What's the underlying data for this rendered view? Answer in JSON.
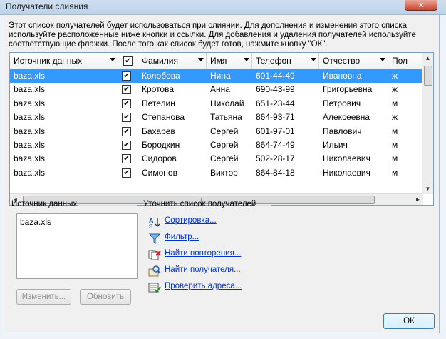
{
  "window": {
    "title": "Получатели слияния",
    "close_label": "x"
  },
  "description": "Этот список получателей будет использоваться при слиянии. Для дополнения и изменения этого списка используйте расположенные ниже кнопки и ссылки. Для добавления и удаления получателей используйте соответствующие флажки. После того как список будет готов, нажмите кнопку \"ОК\".",
  "grid": {
    "columns": [
      "Источник данных",
      "",
      "Фамилия",
      "Имя",
      "Телефон",
      "Отчество",
      "Пол"
    ],
    "rows": [
      {
        "source": "baza.xls",
        "checked": true,
        "last": "Колобова",
        "first": "Нина",
        "phone": "601-44-49",
        "patronymic": "Ивановна",
        "gender": "ж"
      },
      {
        "source": "baza.xls",
        "checked": true,
        "last": "Кротова",
        "first": "Анна",
        "phone": "690-43-99",
        "patronymic": "Григорьевна",
        "gender": "ж"
      },
      {
        "source": "baza.xls",
        "checked": true,
        "last": "Петелин",
        "first": "Николай",
        "phone": "651-23-44",
        "patronymic": "Петрович",
        "gender": "м"
      },
      {
        "source": "baza.xls",
        "checked": true,
        "last": "Степанова",
        "first": "Татьяна",
        "phone": "864-93-71",
        "patronymic": "Алексеевна",
        "gender": "ж"
      },
      {
        "source": "baza.xls",
        "checked": true,
        "last": "Бахарев",
        "first": "Сергей",
        "phone": "601-97-01",
        "patronymic": "Павлович",
        "gender": "м"
      },
      {
        "source": "baza.xls",
        "checked": true,
        "last": "Бородкин",
        "first": "Сергей",
        "phone": "864-74-49",
        "patronymic": "Ильич",
        "gender": "м"
      },
      {
        "source": "baza.xls",
        "checked": true,
        "last": "Сидоров",
        "first": "Сергей",
        "phone": "502-28-17",
        "patronymic": "Николаевич",
        "gender": "м"
      },
      {
        "source": "baza.xls",
        "checked": true,
        "last": "Симонов",
        "first": "Виктор",
        "phone": "864-84-18",
        "patronymic": "Николаевич",
        "gender": "м"
      }
    ],
    "check_mark": "✔"
  },
  "datasource": {
    "label": "Источник данных",
    "items": [
      "baza.xls"
    ]
  },
  "buttons": {
    "edit": "Изменить...",
    "refresh": "Обновить",
    "ok": "ОК"
  },
  "refine": {
    "label": "Уточнить список получателей",
    "links": [
      {
        "text": "Сортировка...",
        "icon": "sort-icon"
      },
      {
        "text": "Фильтр...",
        "icon": "filter-icon"
      },
      {
        "text": "Найти повторения...",
        "icon": "find-duplicates-icon"
      },
      {
        "text": "Найти получателя...",
        "icon": "find-recipient-icon"
      },
      {
        "text": "Проверить адреса...",
        "icon": "validate-addresses-icon"
      }
    ]
  },
  "colors": {
    "selection": "#3399ff",
    "link": "#0033cc"
  }
}
